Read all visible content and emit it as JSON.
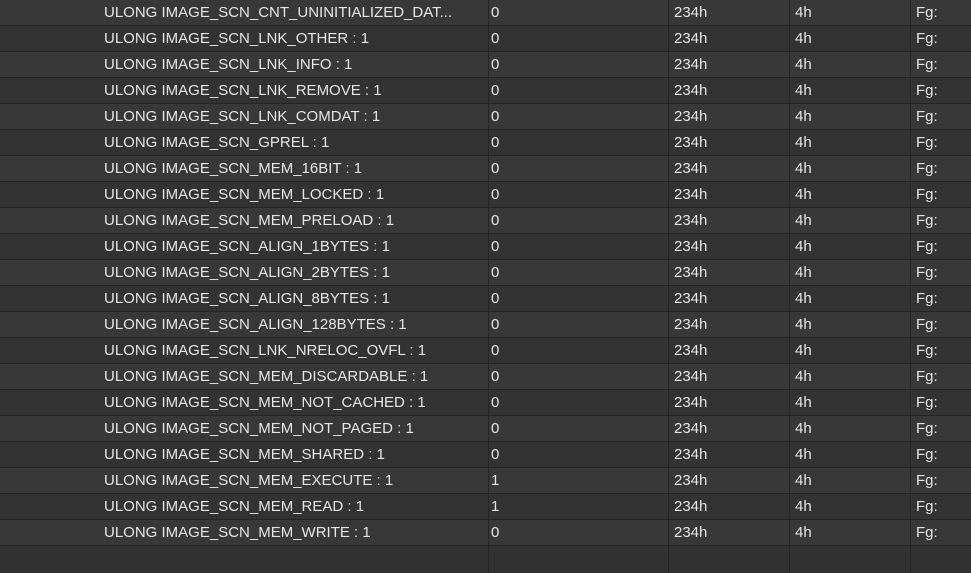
{
  "rows": [
    {
      "name": "ULONG IMAGE_SCN_CNT_UNINITIALIZED_DAT...",
      "value": "0",
      "start": "234h",
      "size": "4h",
      "color": "Fg:"
    },
    {
      "name": "ULONG IMAGE_SCN_LNK_OTHER : 1",
      "value": "0",
      "start": "234h",
      "size": "4h",
      "color": "Fg:"
    },
    {
      "name": "ULONG IMAGE_SCN_LNK_INFO : 1",
      "value": "0",
      "start": "234h",
      "size": "4h",
      "color": "Fg:"
    },
    {
      "name": "ULONG IMAGE_SCN_LNK_REMOVE : 1",
      "value": "0",
      "start": "234h",
      "size": "4h",
      "color": "Fg:"
    },
    {
      "name": "ULONG IMAGE_SCN_LNK_COMDAT : 1",
      "value": "0",
      "start": "234h",
      "size": "4h",
      "color": "Fg:"
    },
    {
      "name": "ULONG IMAGE_SCN_GPREL : 1",
      "value": "0",
      "start": "234h",
      "size": "4h",
      "color": "Fg:"
    },
    {
      "name": "ULONG IMAGE_SCN_MEM_16BIT : 1",
      "value": "0",
      "start": "234h",
      "size": "4h",
      "color": "Fg:"
    },
    {
      "name": "ULONG IMAGE_SCN_MEM_LOCKED : 1",
      "value": "0",
      "start": "234h",
      "size": "4h",
      "color": "Fg:"
    },
    {
      "name": "ULONG IMAGE_SCN_MEM_PRELOAD : 1",
      "value": "0",
      "start": "234h",
      "size": "4h",
      "color": "Fg:"
    },
    {
      "name": "ULONG IMAGE_SCN_ALIGN_1BYTES : 1",
      "value": "0",
      "start": "234h",
      "size": "4h",
      "color": "Fg:"
    },
    {
      "name": "ULONG IMAGE_SCN_ALIGN_2BYTES : 1",
      "value": "0",
      "start": "234h",
      "size": "4h",
      "color": "Fg:"
    },
    {
      "name": "ULONG IMAGE_SCN_ALIGN_8BYTES : 1",
      "value": "0",
      "start": "234h",
      "size": "4h",
      "color": "Fg:"
    },
    {
      "name": "ULONG IMAGE_SCN_ALIGN_128BYTES : 1",
      "value": "0",
      "start": "234h",
      "size": "4h",
      "color": "Fg:"
    },
    {
      "name": "ULONG IMAGE_SCN_LNK_NRELOC_OVFL : 1",
      "value": "0",
      "start": "234h",
      "size": "4h",
      "color": "Fg:"
    },
    {
      "name": "ULONG IMAGE_SCN_MEM_DISCARDABLE : 1",
      "value": "0",
      "start": "234h",
      "size": "4h",
      "color": "Fg:"
    },
    {
      "name": "ULONG IMAGE_SCN_MEM_NOT_CACHED : 1",
      "value": "0",
      "start": "234h",
      "size": "4h",
      "color": "Fg:"
    },
    {
      "name": "ULONG IMAGE_SCN_MEM_NOT_PAGED : 1",
      "value": "0",
      "start": "234h",
      "size": "4h",
      "color": "Fg:"
    },
    {
      "name": "ULONG IMAGE_SCN_MEM_SHARED : 1",
      "value": "0",
      "start": "234h",
      "size": "4h",
      "color": "Fg:"
    },
    {
      "name": "ULONG IMAGE_SCN_MEM_EXECUTE : 1",
      "value": "1",
      "start": "234h",
      "size": "4h",
      "color": "Fg:"
    },
    {
      "name": "ULONG IMAGE_SCN_MEM_READ : 1",
      "value": "1",
      "start": "234h",
      "size": "4h",
      "color": "Fg:"
    },
    {
      "name": "ULONG IMAGE_SCN_MEM_WRITE : 1",
      "value": "0",
      "start": "234h",
      "size": "4h",
      "color": "Fg:"
    }
  ]
}
